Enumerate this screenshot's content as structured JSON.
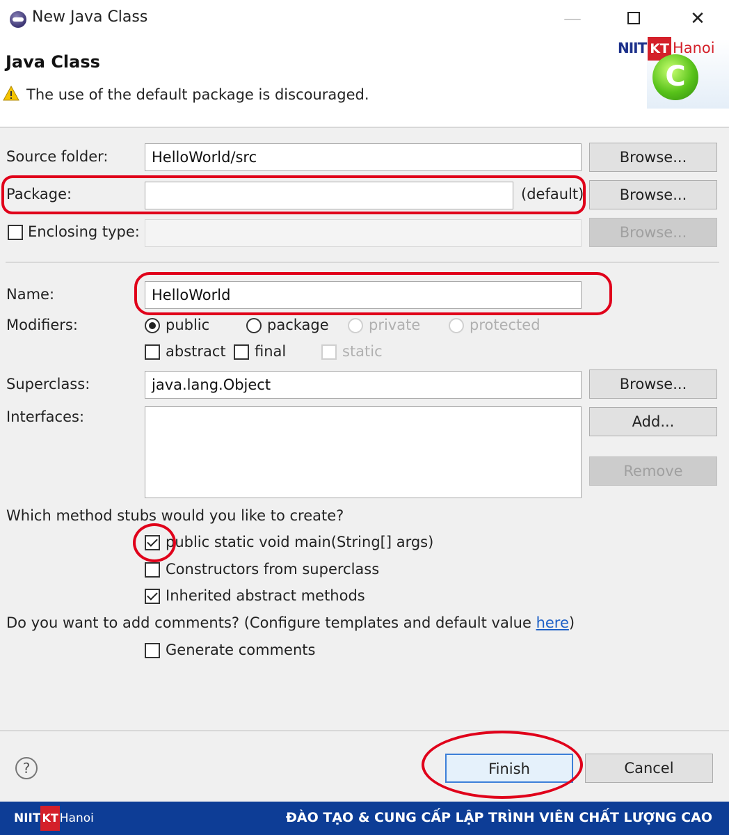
{
  "window": {
    "title": "New Java Class",
    "minimize": "—",
    "close": "✕"
  },
  "header": {
    "heading": "Java Class",
    "warning": "The use of the default package is discouraged.",
    "logo": {
      "niit": "NIIT",
      "kt": "KT",
      "hanoi": "Hanoi",
      "icon_letter": "C"
    }
  },
  "form": {
    "source_folder": {
      "label": "Source folder:",
      "value": "HelloWorld/src",
      "button": "Browse..."
    },
    "package": {
      "label": "Package:",
      "value": "",
      "default_hint": "(default)",
      "button": "Browse..."
    },
    "enclosing_type": {
      "label": "Enclosing type:",
      "checked": false,
      "value": "",
      "button": "Browse..."
    },
    "name": {
      "label": "Name:",
      "value": "HelloWorld"
    },
    "modifiers": {
      "label": "Modifiers:",
      "access": [
        {
          "label": "public",
          "selected": true,
          "enabled": true
        },
        {
          "label": "package",
          "selected": false,
          "enabled": true
        },
        {
          "label": "private",
          "selected": false,
          "enabled": false
        },
        {
          "label": "protected",
          "selected": false,
          "enabled": false
        }
      ],
      "flags": [
        {
          "label": "abstract",
          "checked": false,
          "enabled": true
        },
        {
          "label": "final",
          "checked": false,
          "enabled": true
        },
        {
          "label": "static",
          "checked": false,
          "enabled": false
        }
      ]
    },
    "superclass": {
      "label": "Superclass:",
      "value": "java.lang.Object",
      "button": "Browse..."
    },
    "interfaces": {
      "label": "Interfaces:",
      "add_button": "Add...",
      "remove_button": "Remove"
    },
    "stubs": {
      "question": "Which method stubs would you like to create?",
      "options": [
        {
          "label": "public static void main(String[] args)",
          "checked": true
        },
        {
          "label": "Constructors from superclass",
          "checked": false
        },
        {
          "label": "Inherited abstract methods",
          "checked": true
        }
      ]
    },
    "comments": {
      "question_prefix": "Do you want to add comments? (Configure templates and default value ",
      "link": "here",
      "question_suffix": ")",
      "option": {
        "label": "Generate comments",
        "checked": false
      }
    }
  },
  "buttons": {
    "help": "?",
    "finish": "Finish",
    "cancel": "Cancel"
  },
  "footer": {
    "logo": {
      "niit": "NIIT",
      "kt": "KT",
      "hanoi": "Hanoi"
    },
    "slogan": "ĐÀO TẠO & CUNG CẤP LẬP TRÌNH VIÊN CHẤT LƯỢNG CAO"
  },
  "colors": {
    "annotation_red": "#e0001a",
    "footer_blue": "#0d3d96",
    "link_blue": "#1c5fc6",
    "brand_red": "#d4202a"
  }
}
